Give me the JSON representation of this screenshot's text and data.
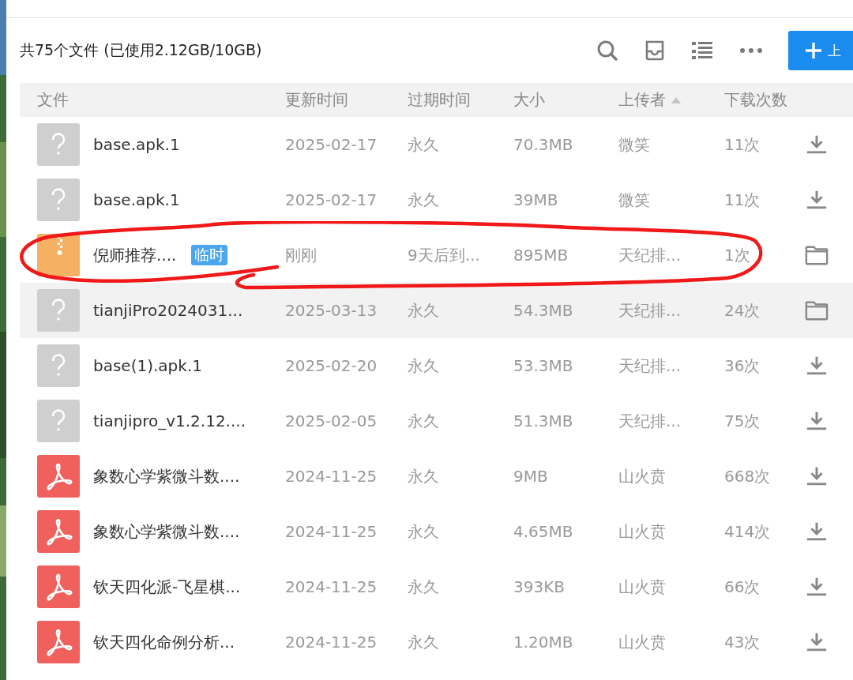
{
  "summary": "共75个文件 (已使用2.12GB/10GB)",
  "upload_button": {
    "label": "上"
  },
  "columns": [
    {
      "label": "文件",
      "sorted": false
    },
    {
      "label": "更新时间",
      "sorted": false
    },
    {
      "label": "过期时间",
      "sorted": false
    },
    {
      "label": "大小",
      "sorted": false
    },
    {
      "label": "上传者",
      "sorted": true
    },
    {
      "label": "下载次数",
      "sorted": false
    }
  ],
  "rows": [
    {
      "icon": {
        "kind": "unknown"
      },
      "name": "base.apk.1",
      "updated": "2025-02-17",
      "expires": "永久",
      "size": "70.3MB",
      "uploader": "微笑",
      "downloads": "11次",
      "action": {
        "kind": "download"
      },
      "highlighted": false,
      "circled": false
    },
    {
      "icon": {
        "kind": "unknown"
      },
      "name": "base.apk.1",
      "updated": "2025-02-17",
      "expires": "永久",
      "size": "39MB",
      "uploader": "微笑",
      "downloads": "11次",
      "action": {
        "kind": "download"
      },
      "highlighted": false,
      "circled": false
    },
    {
      "icon": {
        "kind": "zip"
      },
      "name": "倪师推荐....",
      "tag": "临时",
      "updated": "刚刚",
      "expires": "9天后到...",
      "size": "895MB",
      "uploader": "天纪排...",
      "downloads": "1次",
      "action": {
        "kind": "folder"
      },
      "highlighted": false,
      "circled": true
    },
    {
      "icon": {
        "kind": "unknown"
      },
      "name": "tianjiPro2024031...",
      "updated": "2025-03-13",
      "expires": "永久",
      "size": "54.3MB",
      "uploader": "天纪排...",
      "downloads": "24次",
      "action": {
        "kind": "folder"
      },
      "highlighted": true,
      "circled": false
    },
    {
      "icon": {
        "kind": "unknown"
      },
      "name": "base(1).apk.1",
      "updated": "2025-02-20",
      "expires": "永久",
      "size": "53.3MB",
      "uploader": "天纪排...",
      "downloads": "36次",
      "action": {
        "kind": "download"
      },
      "highlighted": false,
      "circled": false
    },
    {
      "icon": {
        "kind": "unknown"
      },
      "name": "tianjipro_v1.2.12....",
      "updated": "2025-02-05",
      "expires": "永久",
      "size": "51.3MB",
      "uploader": "天纪排...",
      "downloads": "75次",
      "action": {
        "kind": "download"
      },
      "highlighted": false,
      "circled": false
    },
    {
      "icon": {
        "kind": "pdf"
      },
      "name": "象数心学紫微斗数....",
      "updated": "2024-11-25",
      "expires": "永久",
      "size": "9MB",
      "uploader": "山火贲",
      "downloads": "668次",
      "action": {
        "kind": "download"
      },
      "highlighted": false,
      "circled": false
    },
    {
      "icon": {
        "kind": "pdf"
      },
      "name": "象数心学紫微斗数....",
      "updated": "2024-11-25",
      "expires": "永久",
      "size": "4.65MB",
      "uploader": "山火贲",
      "downloads": "414次",
      "action": {
        "kind": "download"
      },
      "highlighted": false,
      "circled": false
    },
    {
      "icon": {
        "kind": "pdf"
      },
      "name": "钦天四化派-飞星棋...",
      "updated": "2024-11-25",
      "expires": "永久",
      "size": "393KB",
      "uploader": "山火贲",
      "downloads": "66次",
      "action": {
        "kind": "download"
      },
      "highlighted": false,
      "circled": false
    },
    {
      "icon": {
        "kind": "pdf"
      },
      "name": "钦天四化命例分析...",
      "updated": "2024-11-25",
      "expires": "永久",
      "size": "1.20MB",
      "uploader": "山火贲",
      "downloads": "43次",
      "action": {
        "kind": "download"
      },
      "highlighted": false,
      "circled": false
    }
  ]
}
